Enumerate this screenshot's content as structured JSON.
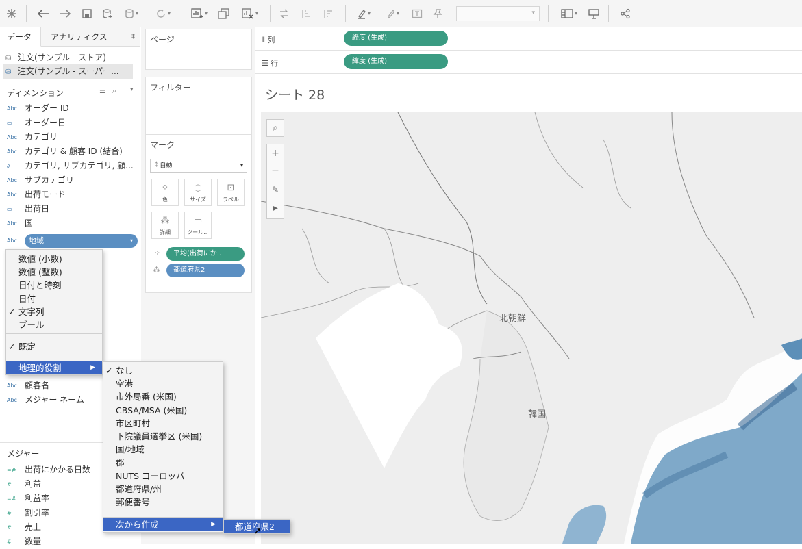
{
  "toolbar": {
    "dropdown_value": ""
  },
  "left": {
    "tab_data": "データ",
    "tab_analytics": "アナリティクス",
    "tab_analytics_icon": "‡",
    "datasources": [
      "注文(サンプル - ストア)",
      "注文(サンプル - スーパー..."
    ],
    "dimensions_header": "ディメンション",
    "dimensions": [
      {
        "type": "Abc",
        "label": "オーダー ID"
      },
      {
        "type": "date",
        "label": "オーダー日"
      },
      {
        "type": "Abc",
        "label": "カテゴリ"
      },
      {
        "type": "Abc",
        "label": "カテゴリ & 顧客 ID (結合)"
      },
      {
        "type": "link",
        "label": "カテゴリ, サブカテゴリ, 顧..."
      },
      {
        "type": "Abc",
        "label": "サブカテゴリ"
      },
      {
        "type": "Abc",
        "label": "出荷モード"
      },
      {
        "type": "date",
        "label": "出荷日"
      },
      {
        "type": "Abc",
        "label": "国"
      }
    ],
    "selected_field": {
      "type": "Abc",
      "label": "地域"
    },
    "dimensions_after": [
      {
        "type": "Abc",
        "label": "顧客名"
      },
      {
        "type": "Abc",
        "label": "メジャー ネーム"
      }
    ],
    "measures_header": "メジャー",
    "measures": [
      {
        "type": "=#",
        "label": "出荷にかかる日数"
      },
      {
        "type": "#",
        "label": "利益"
      },
      {
        "type": "=#",
        "label": "利益率"
      },
      {
        "type": "#",
        "label": "割引率"
      },
      {
        "type": "#",
        "label": "売上"
      },
      {
        "type": "#",
        "label": "数量"
      }
    ]
  },
  "shelves": {
    "pages": "ページ",
    "filters": "フィルター",
    "marks": "マーク",
    "marks_type": "自動",
    "mark_buttons": [
      "色",
      "サイズ",
      "ラベル",
      "詳細",
      "ツール..."
    ],
    "mark_pills": [
      {
        "label": "平均(出荷にか..",
        "color": "#3a9b82"
      },
      {
        "label": "都道府県2",
        "color": "#5b8fc2"
      }
    ]
  },
  "columns": {
    "label": "列",
    "pill": "経度 (生成)"
  },
  "rows": {
    "label": "行",
    "pill": "緯度 (生成)"
  },
  "sheet": {
    "title": "シート 28",
    "map_labels": [
      "北朝鮮",
      "韓国"
    ]
  },
  "menu1": {
    "items": [
      {
        "label": "数値 (小数)",
        "checked": false
      },
      {
        "label": "数値 (整数)",
        "checked": false
      },
      {
        "label": "日付と時刻",
        "checked": false
      },
      {
        "label": "日付",
        "checked": false
      },
      {
        "label": "文字列",
        "checked": true
      },
      {
        "label": "ブール",
        "checked": false
      }
    ],
    "default_label": "既定",
    "geo_label": "地理的役割"
  },
  "menu2": {
    "items": [
      {
        "label": "なし",
        "checked": true
      },
      {
        "label": "空港",
        "checked": false
      },
      {
        "label": "市外局番 (米国)",
        "checked": false
      },
      {
        "label": "CBSA/MSA (米国)",
        "checked": false
      },
      {
        "label": "市区町村",
        "checked": false
      },
      {
        "label": "下院議員選挙区 (米国)",
        "checked": false
      },
      {
        "label": "国/地域",
        "checked": false
      },
      {
        "label": "郡",
        "checked": false
      },
      {
        "label": "NUTS ヨーロッパ",
        "checked": false
      },
      {
        "label": "都道府県/州",
        "checked": false
      },
      {
        "label": "郵便番号",
        "checked": false
      }
    ],
    "create_from": "次から作成"
  },
  "menu3": {
    "item": "都道府県2"
  },
  "colors": {
    "accent_green": "#3a9b82",
    "accent_blue": "#5b8fc2",
    "menu_highlight": "#3b66c4"
  }
}
